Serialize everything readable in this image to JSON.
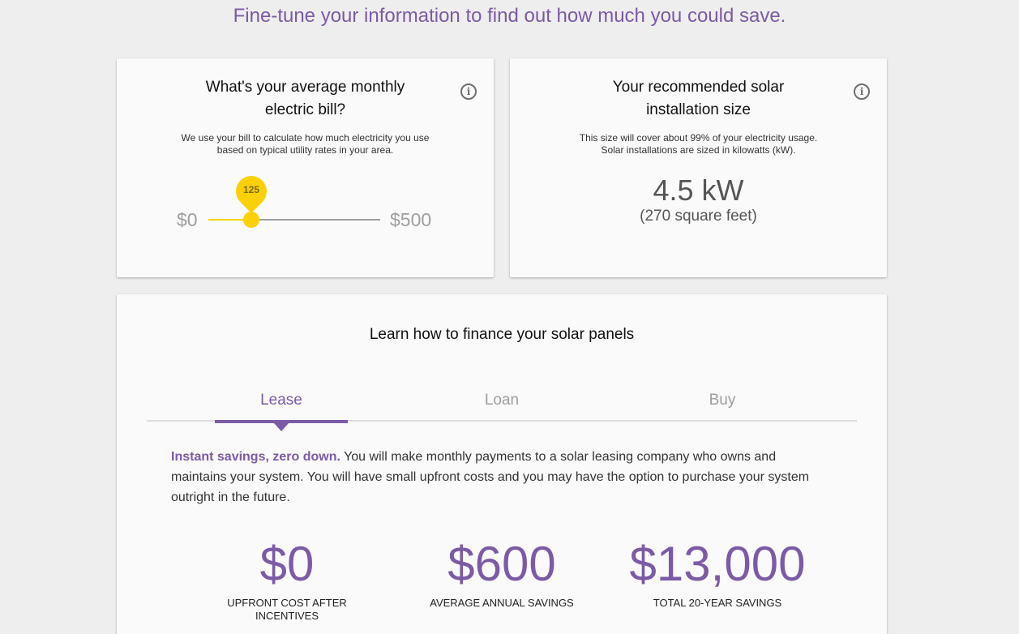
{
  "headline": "Fine-tune your information to find out how much you could save.",
  "bill_card": {
    "title": "What's your average monthly electric bill?",
    "description_line1": "We use your bill to calculate how much electricity you use",
    "description_line2": "based on typical utility rates in your area.",
    "slider": {
      "min_label": "$0",
      "max_label": "$500",
      "min": 0,
      "max": 500,
      "value": 125,
      "value_label": "125"
    }
  },
  "size_card": {
    "title_line1": "Your recommended solar",
    "title_line2": "installation size",
    "description_line1": "This size will cover about 99% of your electricity usage.",
    "description_line2": "Solar installations are sized in kilowatts (kW).",
    "size_value": "4.5 kW",
    "size_area": "(270 square feet)"
  },
  "finance_card": {
    "title": "Learn how to finance your solar panels",
    "tabs": [
      {
        "label": "Lease",
        "active": true
      },
      {
        "label": "Loan",
        "active": false
      },
      {
        "label": "Buy",
        "active": false
      }
    ],
    "lead": "Instant savings, zero down.",
    "description": " You will make monthly payments to a solar leasing company who owns and maintains your system. You will have small upfront costs and you may have the option to purchase your system outright in the future.",
    "stats": [
      {
        "value": "$0",
        "label": "UPFRONT COST AFTER INCENTIVES"
      },
      {
        "value": "$600",
        "label": "AVERAGE ANNUAL SAVINGS"
      },
      {
        "value": "$13,000",
        "label": "TOTAL 20-YEAR SAVINGS"
      }
    ]
  },
  "colors": {
    "accent": "#7b5aa6",
    "slider": "#fbd105",
    "background": "#eeeeee",
    "card": "#fafafa"
  },
  "icons": {
    "info": "info-circle-icon"
  }
}
